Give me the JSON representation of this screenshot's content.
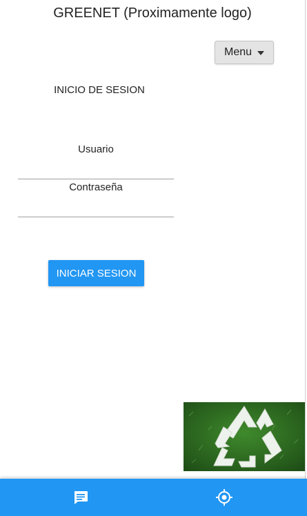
{
  "header": {
    "title": "GREENET (Proximamente logo)",
    "menu_label": "Menu"
  },
  "login": {
    "heading": "INICIO DE SESION",
    "username_label": "Usuario",
    "password_label": "Contraseña",
    "submit_label": "INICIAR SESION"
  },
  "bottom_nav": {
    "items": [
      {
        "icon": "chat-icon"
      },
      {
        "icon": "location-target-icon"
      }
    ]
  },
  "colors": {
    "accent": "#2196f3",
    "nav_icon": "#ffffff",
    "image_background": "#2f6b22",
    "recycle_symbol": "#eef2ec"
  }
}
